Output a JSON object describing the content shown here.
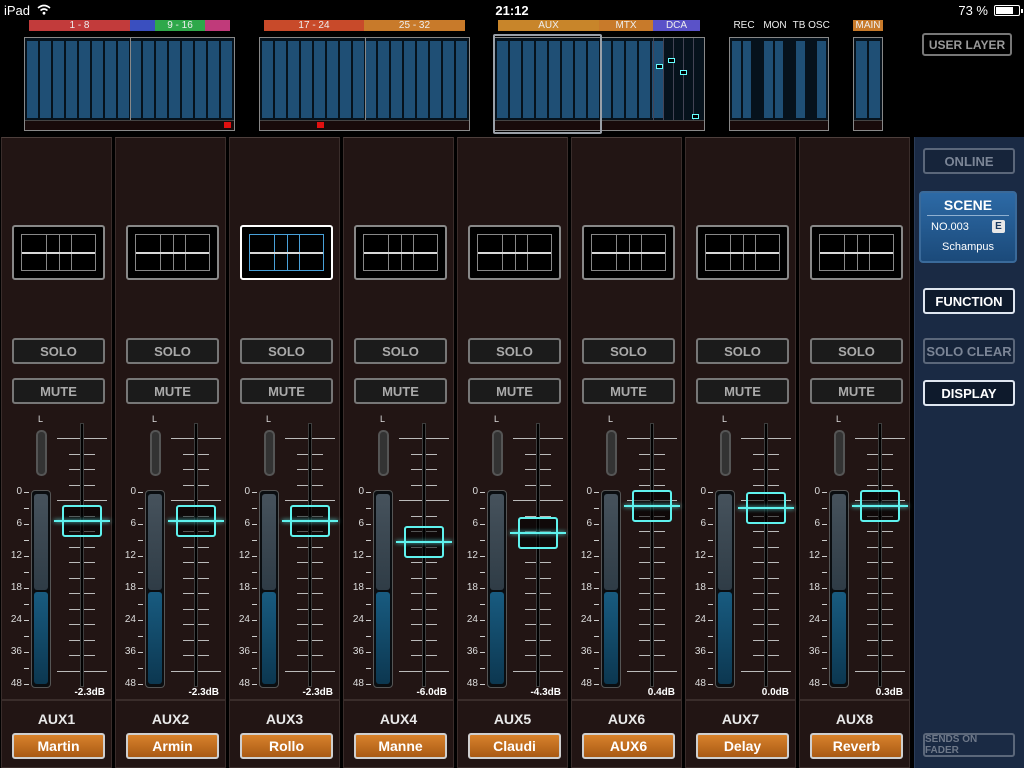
{
  "status_bar": {
    "device": "iPad",
    "time": "21:12",
    "battery": "73 %"
  },
  "overview": {
    "bank_labels": [
      "1 - 8",
      "9 - 16",
      "17 - 24",
      "25 - 32",
      "AUX",
      "MTX",
      "DCA",
      "REC",
      "MON",
      "TB",
      "OSC",
      "MAIN"
    ],
    "user_layer_label": "USER LAYER"
  },
  "channels": [
    {
      "aux": "AUX1",
      "name": "Martin",
      "fader_db": "-2.3dB",
      "level": -2.3
    },
    {
      "aux": "AUX2",
      "name": "Armin",
      "fader_db": "-2.3dB",
      "level": -2.3
    },
    {
      "aux": "AUX3",
      "name": "Rollo",
      "fader_db": "-2.3dB",
      "level": -2.3
    },
    {
      "aux": "AUX4",
      "name": "Manne",
      "fader_db": "-6.0dB",
      "level": -6.0
    },
    {
      "aux": "AUX5",
      "name": "Claudi",
      "fader_db": "-4.3dB",
      "level": -4.3
    },
    {
      "aux": "AUX6",
      "name": "AUX6",
      "fader_db": "0.4dB",
      "level": 0.4
    },
    {
      "aux": "AUX7",
      "name": "Delay",
      "fader_db": "0.0dB",
      "level": 0.0
    },
    {
      "aux": "AUX8",
      "name": "Reverb",
      "fader_db": "0.3dB",
      "level": 0.3
    }
  ],
  "strip": {
    "solo_label": "SOLO",
    "mute_label": "MUTE",
    "pan_label": "L",
    "meter_scale": [
      "0",
      "6",
      "12",
      "18",
      "24",
      "36",
      "48"
    ]
  },
  "panel": {
    "online_label": "ONLINE",
    "scene_title": "SCENE",
    "scene_number": "NO.003",
    "scene_flag": "E",
    "scene_name": "Schampus",
    "function_label": "FUNCTION",
    "solo_clear_label": "SOLO CLEAR",
    "display_label": "DISPLAY",
    "sends_label": "SENDS ON FADER"
  },
  "colors": {
    "fader_accent": "#5ff2ee",
    "name_tag": "#c8701e",
    "panel_bg": "#1a2a44"
  }
}
